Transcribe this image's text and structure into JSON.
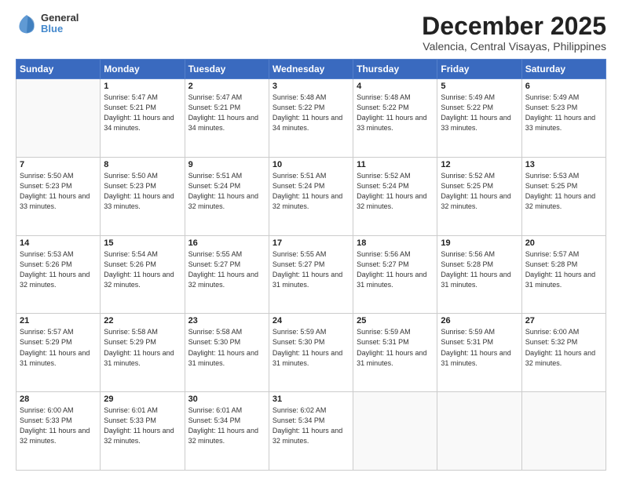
{
  "logo": {
    "general": "General",
    "blue": "Blue"
  },
  "title": "December 2025",
  "location": "Valencia, Central Visayas, Philippines",
  "days_header": [
    "Sunday",
    "Monday",
    "Tuesday",
    "Wednesday",
    "Thursday",
    "Friday",
    "Saturday"
  ],
  "weeks": [
    [
      {
        "day": "",
        "sunrise": "",
        "sunset": "",
        "daylight": ""
      },
      {
        "day": "1",
        "sunrise": "Sunrise: 5:47 AM",
        "sunset": "Sunset: 5:21 PM",
        "daylight": "Daylight: 11 hours and 34 minutes."
      },
      {
        "day": "2",
        "sunrise": "Sunrise: 5:47 AM",
        "sunset": "Sunset: 5:21 PM",
        "daylight": "Daylight: 11 hours and 34 minutes."
      },
      {
        "day": "3",
        "sunrise": "Sunrise: 5:48 AM",
        "sunset": "Sunset: 5:22 PM",
        "daylight": "Daylight: 11 hours and 34 minutes."
      },
      {
        "day": "4",
        "sunrise": "Sunrise: 5:48 AM",
        "sunset": "Sunset: 5:22 PM",
        "daylight": "Daylight: 11 hours and 33 minutes."
      },
      {
        "day": "5",
        "sunrise": "Sunrise: 5:49 AM",
        "sunset": "Sunset: 5:22 PM",
        "daylight": "Daylight: 11 hours and 33 minutes."
      },
      {
        "day": "6",
        "sunrise": "Sunrise: 5:49 AM",
        "sunset": "Sunset: 5:23 PM",
        "daylight": "Daylight: 11 hours and 33 minutes."
      }
    ],
    [
      {
        "day": "7",
        "sunrise": "Sunrise: 5:50 AM",
        "sunset": "Sunset: 5:23 PM",
        "daylight": "Daylight: 11 hours and 33 minutes."
      },
      {
        "day": "8",
        "sunrise": "Sunrise: 5:50 AM",
        "sunset": "Sunset: 5:23 PM",
        "daylight": "Daylight: 11 hours and 33 minutes."
      },
      {
        "day": "9",
        "sunrise": "Sunrise: 5:51 AM",
        "sunset": "Sunset: 5:24 PM",
        "daylight": "Daylight: 11 hours and 32 minutes."
      },
      {
        "day": "10",
        "sunrise": "Sunrise: 5:51 AM",
        "sunset": "Sunset: 5:24 PM",
        "daylight": "Daylight: 11 hours and 32 minutes."
      },
      {
        "day": "11",
        "sunrise": "Sunrise: 5:52 AM",
        "sunset": "Sunset: 5:24 PM",
        "daylight": "Daylight: 11 hours and 32 minutes."
      },
      {
        "day": "12",
        "sunrise": "Sunrise: 5:52 AM",
        "sunset": "Sunset: 5:25 PM",
        "daylight": "Daylight: 11 hours and 32 minutes."
      },
      {
        "day": "13",
        "sunrise": "Sunrise: 5:53 AM",
        "sunset": "Sunset: 5:25 PM",
        "daylight": "Daylight: 11 hours and 32 minutes."
      }
    ],
    [
      {
        "day": "14",
        "sunrise": "Sunrise: 5:53 AM",
        "sunset": "Sunset: 5:26 PM",
        "daylight": "Daylight: 11 hours and 32 minutes."
      },
      {
        "day": "15",
        "sunrise": "Sunrise: 5:54 AM",
        "sunset": "Sunset: 5:26 PM",
        "daylight": "Daylight: 11 hours and 32 minutes."
      },
      {
        "day": "16",
        "sunrise": "Sunrise: 5:55 AM",
        "sunset": "Sunset: 5:27 PM",
        "daylight": "Daylight: 11 hours and 32 minutes."
      },
      {
        "day": "17",
        "sunrise": "Sunrise: 5:55 AM",
        "sunset": "Sunset: 5:27 PM",
        "daylight": "Daylight: 11 hours and 31 minutes."
      },
      {
        "day": "18",
        "sunrise": "Sunrise: 5:56 AM",
        "sunset": "Sunset: 5:27 PM",
        "daylight": "Daylight: 11 hours and 31 minutes."
      },
      {
        "day": "19",
        "sunrise": "Sunrise: 5:56 AM",
        "sunset": "Sunset: 5:28 PM",
        "daylight": "Daylight: 11 hours and 31 minutes."
      },
      {
        "day": "20",
        "sunrise": "Sunrise: 5:57 AM",
        "sunset": "Sunset: 5:28 PM",
        "daylight": "Daylight: 11 hours and 31 minutes."
      }
    ],
    [
      {
        "day": "21",
        "sunrise": "Sunrise: 5:57 AM",
        "sunset": "Sunset: 5:29 PM",
        "daylight": "Daylight: 11 hours and 31 minutes."
      },
      {
        "day": "22",
        "sunrise": "Sunrise: 5:58 AM",
        "sunset": "Sunset: 5:29 PM",
        "daylight": "Daylight: 11 hours and 31 minutes."
      },
      {
        "day": "23",
        "sunrise": "Sunrise: 5:58 AM",
        "sunset": "Sunset: 5:30 PM",
        "daylight": "Daylight: 11 hours and 31 minutes."
      },
      {
        "day": "24",
        "sunrise": "Sunrise: 5:59 AM",
        "sunset": "Sunset: 5:30 PM",
        "daylight": "Daylight: 11 hours and 31 minutes."
      },
      {
        "day": "25",
        "sunrise": "Sunrise: 5:59 AM",
        "sunset": "Sunset: 5:31 PM",
        "daylight": "Daylight: 11 hours and 31 minutes."
      },
      {
        "day": "26",
        "sunrise": "Sunrise: 5:59 AM",
        "sunset": "Sunset: 5:31 PM",
        "daylight": "Daylight: 11 hours and 31 minutes."
      },
      {
        "day": "27",
        "sunrise": "Sunrise: 6:00 AM",
        "sunset": "Sunset: 5:32 PM",
        "daylight": "Daylight: 11 hours and 32 minutes."
      }
    ],
    [
      {
        "day": "28",
        "sunrise": "Sunrise: 6:00 AM",
        "sunset": "Sunset: 5:33 PM",
        "daylight": "Daylight: 11 hours and 32 minutes."
      },
      {
        "day": "29",
        "sunrise": "Sunrise: 6:01 AM",
        "sunset": "Sunset: 5:33 PM",
        "daylight": "Daylight: 11 hours and 32 minutes."
      },
      {
        "day": "30",
        "sunrise": "Sunrise: 6:01 AM",
        "sunset": "Sunset: 5:34 PM",
        "daylight": "Daylight: 11 hours and 32 minutes."
      },
      {
        "day": "31",
        "sunrise": "Sunrise: 6:02 AM",
        "sunset": "Sunset: 5:34 PM",
        "daylight": "Daylight: 11 hours and 32 minutes."
      },
      {
        "day": "",
        "sunrise": "",
        "sunset": "",
        "daylight": ""
      },
      {
        "day": "",
        "sunrise": "",
        "sunset": "",
        "daylight": ""
      },
      {
        "day": "",
        "sunrise": "",
        "sunset": "",
        "daylight": ""
      }
    ]
  ]
}
